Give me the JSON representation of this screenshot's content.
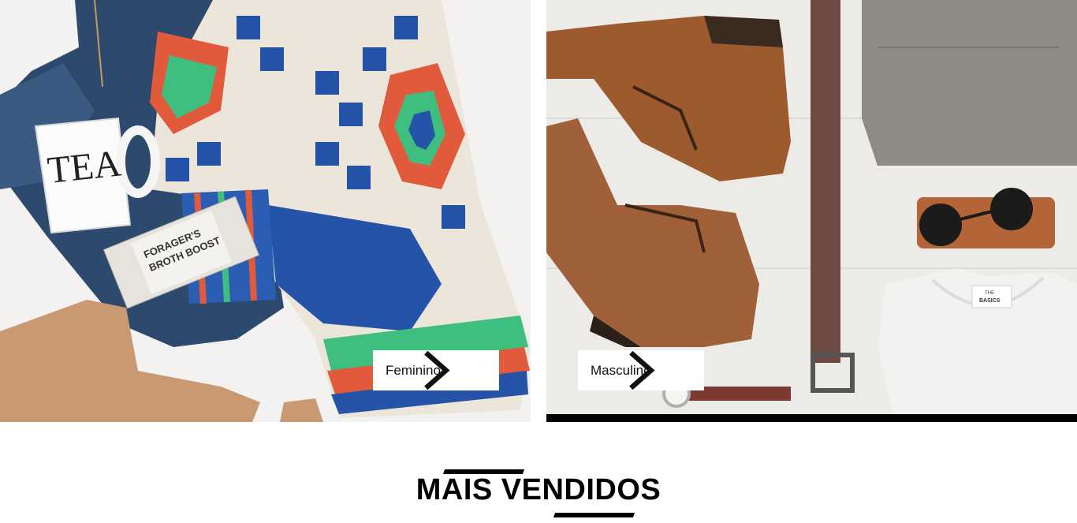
{
  "banners": {
    "feminino": {
      "label": "Feminino",
      "image_text": {
        "mug": "TEA",
        "label_line1": "FORAGER'S",
        "label_line2": "BROTH BOOST"
      }
    },
    "masculino": {
      "label": "Masculino",
      "image_text": {
        "tag_line1": "THE",
        "tag_line2": "BASICS"
      }
    }
  },
  "section": {
    "title": "MAIS VENDIDOS"
  },
  "colors": {
    "accent": "#000000",
    "button_bg": "#ffffff",
    "text": "#111111"
  },
  "icons": {
    "chevron": "chevron-right-icon"
  }
}
